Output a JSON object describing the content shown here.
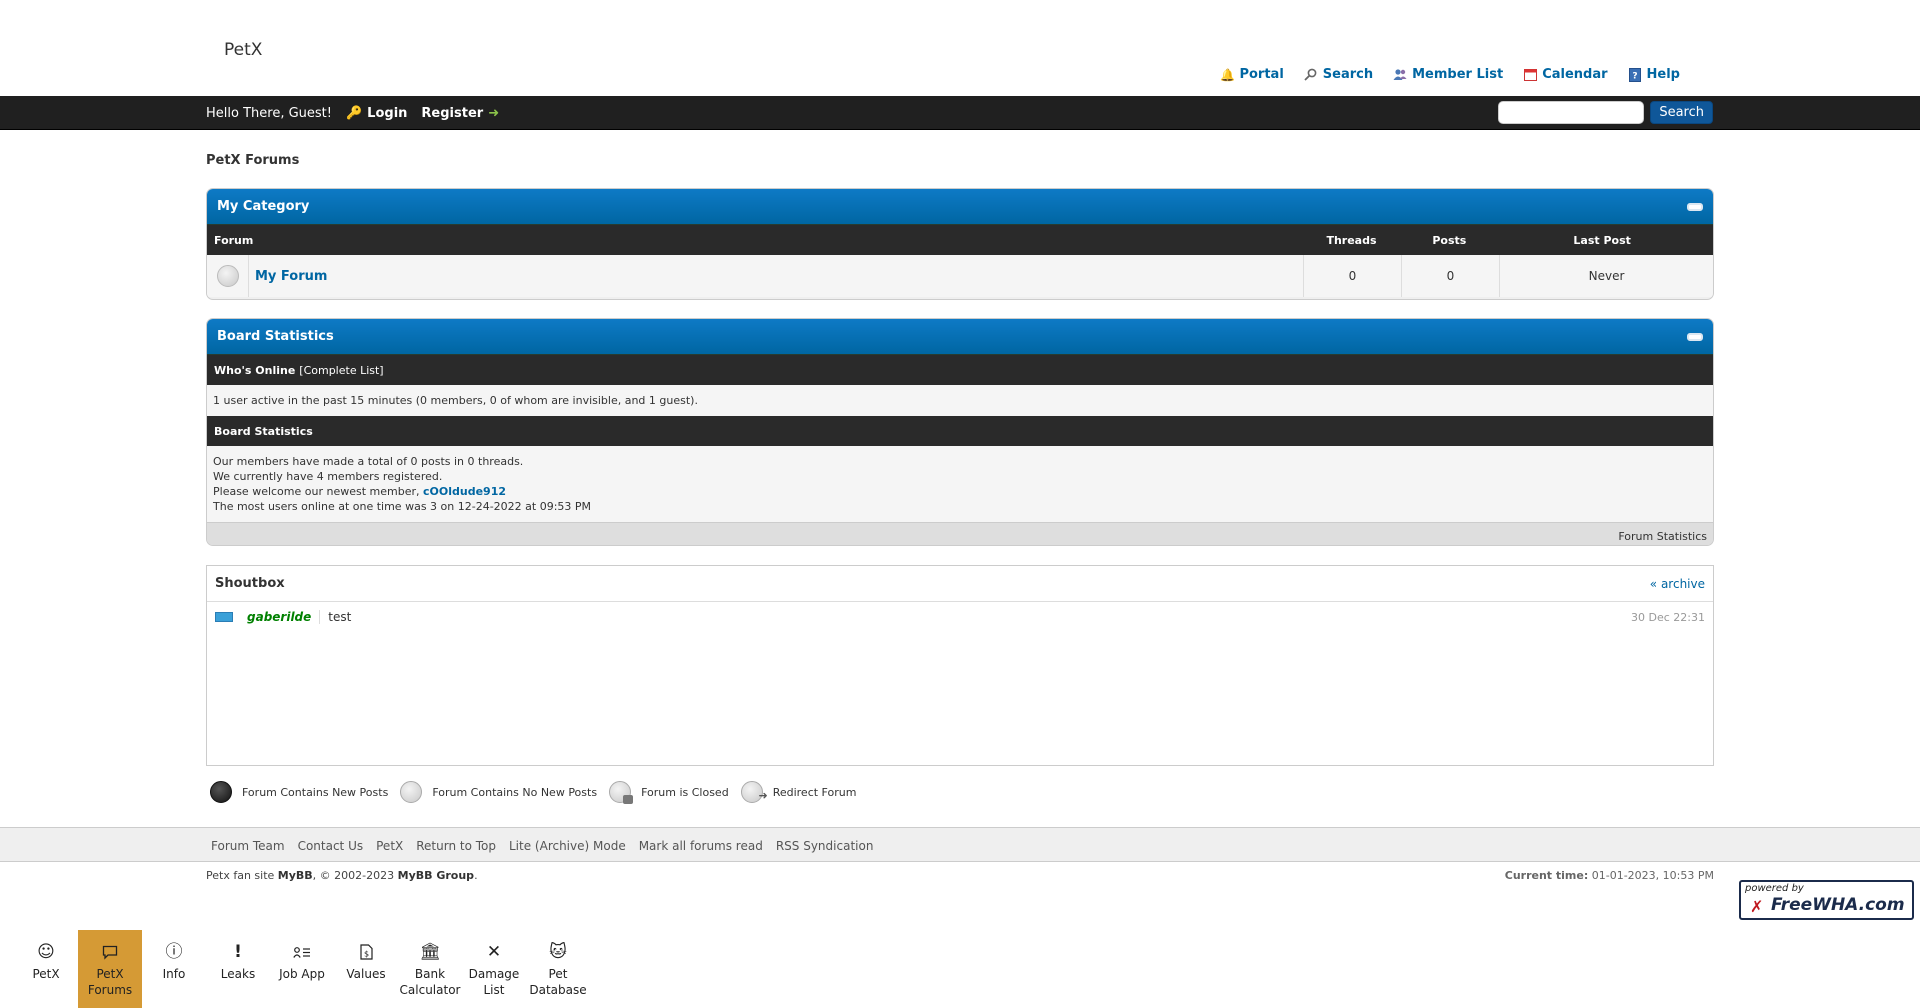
{
  "header": {
    "site_name": "PetX",
    "top_links": [
      {
        "label": "Portal",
        "icon": "bell-icon"
      },
      {
        "label": "Search",
        "icon": "magnifier-icon"
      },
      {
        "label": "Member List",
        "icon": "members-icon"
      },
      {
        "label": "Calendar",
        "icon": "calendar-icon"
      },
      {
        "label": "Help",
        "icon": "help-book-icon"
      }
    ]
  },
  "welcome": {
    "greeting": "Hello There, Guest!",
    "login": "Login",
    "register": "Register",
    "search_button": "Search",
    "search_value": ""
  },
  "breadcrumb": "PetX Forums",
  "category": {
    "title": "My Category",
    "columns": {
      "forum": "Forum",
      "threads": "Threads",
      "posts": "Posts",
      "last_post": "Last Post"
    },
    "forums": [
      {
        "name": "My Forum",
        "threads": "0",
        "posts": "0",
        "last_post": "Never"
      }
    ]
  },
  "stats": {
    "title": "Board Statistics",
    "whos_online_label": "Who's Online",
    "complete_list": "[Complete List]",
    "online_text": "1 user active in the past 15 minutes (0 members, 0 of whom are invisible, and 1 guest).",
    "board_stats_label": "Board Statistics",
    "line1": "Our members have made a total of 0 posts in 0 threads.",
    "line2": "We currently have 4 members registered.",
    "line3_prefix": "Please welcome our newest member,",
    "newest_member": "cOOldude912",
    "line4": "The most users online at one time was 3 on 12-24-2022 at 09:53 PM",
    "footer_link": "Forum Statistics"
  },
  "shoutbox": {
    "title": "Shoutbox",
    "archive": "« archive",
    "messages": [
      {
        "user": "gaberilde",
        "text": "test",
        "time": "30 Dec 22:31"
      }
    ]
  },
  "legend": {
    "new_posts": "Forum Contains New Posts",
    "no_new_posts": "Forum Contains No New Posts",
    "closed": "Forum is Closed",
    "redirect": "Redirect Forum"
  },
  "footer": {
    "links": [
      "Forum Team",
      "Contact Us",
      "PetX",
      "Return to Top",
      "Lite (Archive) Mode",
      "Mark all forums read",
      "RSS Syndication"
    ],
    "copyright_prefix": "Petx fan site",
    "mybb": "MyBB",
    "copyright_mid": ", © 2002-2023",
    "mybb_group": "MyBB Group",
    "copyright_end": ".",
    "current_time_label": "Current time:",
    "current_time": "01-01-2023, 10:53 PM",
    "badge_powered": "powered by",
    "badge_name": "FreeWHA.com"
  },
  "appnav": {
    "active_color": "#d59a35",
    "items": [
      {
        "label": "PetX",
        "icon": "smiley-icon"
      },
      {
        "label": "PetX Forums",
        "icon": "chat-bubble-icon"
      },
      {
        "label": "Info",
        "icon": "info-icon"
      },
      {
        "label": "Leaks",
        "icon": "exclamation-icon"
      },
      {
        "label": "Job App",
        "icon": "profile-list-icon"
      },
      {
        "label": "Values",
        "icon": "document-dollar-icon"
      },
      {
        "label": "Bank Calculator",
        "icon": "bank-icon"
      },
      {
        "label": "Damage List",
        "icon": "x-icon"
      },
      {
        "label": "Pet Database",
        "icon": "cat-icon"
      }
    ]
  },
  "colors": {
    "accent": "#0066a2",
    "header_bar": "#202020",
    "thead_blue": "#0e7ac6"
  }
}
